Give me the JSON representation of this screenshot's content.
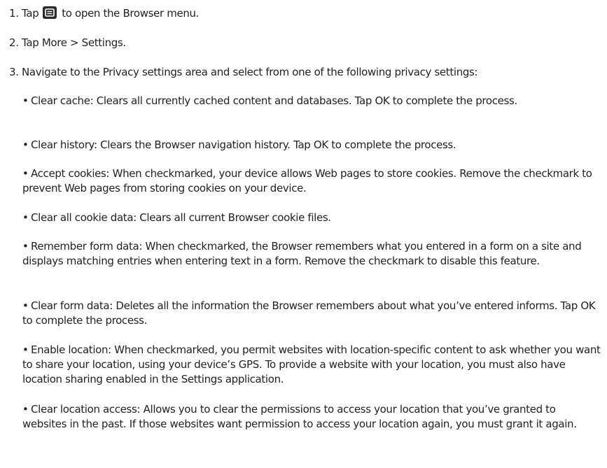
{
  "icons": {
    "menu_key": "menu-key-icon",
    "menu_key_color": "#2b2b2b"
  },
  "steps": [
    {
      "num": "1.",
      "pre": "Tap",
      "post": "to open the Browser menu."
    },
    {
      "num": "2.",
      "pre": "Tap",
      "more": "More",
      "sep": ">",
      "settings": "Settings",
      "end": "."
    },
    {
      "num": "3.",
      "pre": "Navigate to the",
      "area": "Privacy settings",
      "post": "area and select from one of the following privacy settings:"
    }
  ],
  "bullet_symbol": "•",
  "options": [
    {
      "term": "Clear cache",
      "desc": ": Clears all currently cached content and databases. Tap ",
      "ok": "OK",
      "desc2": " to complete the process."
    },
    {
      "term": "Clear history",
      "desc": ": Clears the Browser navigation history. Tap ",
      "ok": "OK",
      "desc2": " to complete the process."
    },
    {
      "term": "Accept cookies",
      "desc": ": When checkmarked, your device allows Web pages to store cookies. Remove the checkmark to prevent Web pages from storing cookies on your device."
    },
    {
      "term": "Clear all cookie data",
      "desc": ": Clears all current Browser cookie files."
    },
    {
      "term": "Remember form data",
      "desc": ": When checkmarked, the Browser remembers what you entered in a form on a site and displays matching entries when entering text in a form. Remove the checkmark to disable this feature."
    },
    {
      "term": "Clear form data",
      "desc": ": Deletes all the information the Browser remembers about what you’ve entered informs. Tap ",
      "ok": "OK",
      "desc2": " to complete the process."
    },
    {
      "term": "Enable location",
      "desc": ": When checkmarked, you permit websites with location-specific content to ask whether you want to share your location, using your device’s GPS. To provide a website with your location, you must also have location sharing enabled in the Settings application."
    },
    {
      "term": "Clear location access",
      "desc": ": Allows you to clear the permissions to access your location that you’ve granted to websites in the past. If those websites want permission to access your location again, you must grant it again."
    }
  ]
}
